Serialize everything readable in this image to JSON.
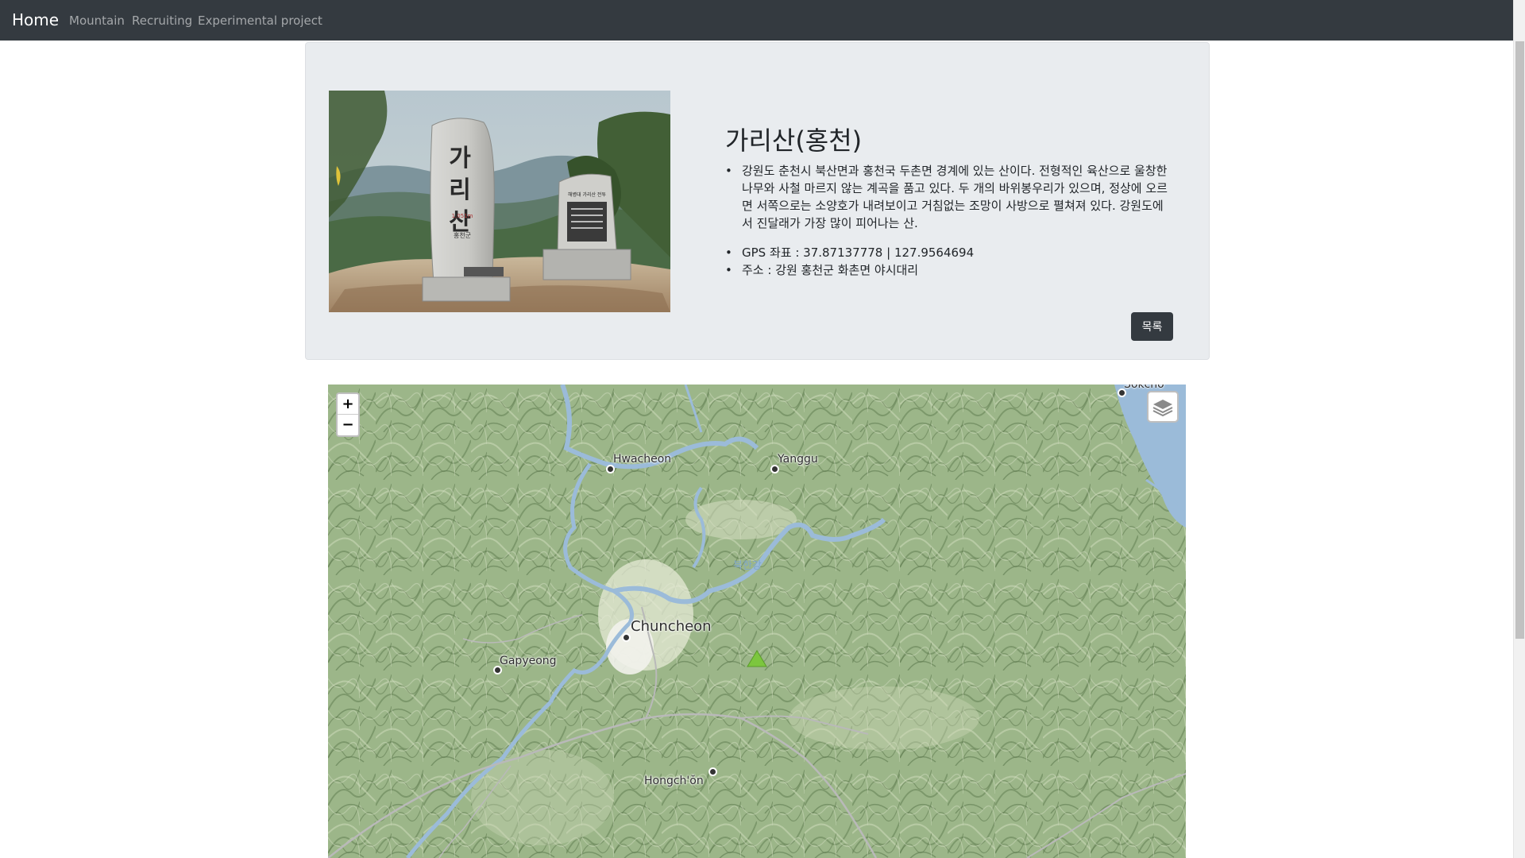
{
  "navbar": {
    "brand": "Home",
    "links": [
      "Mountain",
      "Recruiting",
      "Experimental project"
    ]
  },
  "mountain": {
    "name": "가리산(홍천)",
    "description": "강원도 춘천시 북산면과 홍천국 두촌면 경계에 있는 산이다. 전형적인 육산으로 울창한 나무와 사철 마르지 않는 계곡을 품고 있다. 두 개의 바위봉우리가 있으며, 정상에 오르면 서쪽으로는 소양호가 내려보이고 거침없는 조망이 사방으로 펼쳐져 있다. 강원도에서 진달래가 가장 많이 피어나는 산.",
    "gps": "GPS 좌표 : 37.87137778 | 127.9564694",
    "address": "주소 : 강원 홍천군 화촌면 야시대리",
    "list_button": "목록",
    "photo_text": {
      "stone_text": "가리산",
      "stone_height": "1,051m",
      "stone_county": "홍천군",
      "plaque_title": "해병대 가리산 전투"
    }
  },
  "map": {
    "zoom_in": "+",
    "zoom_out": "−",
    "cities": {
      "hwacheon": "Hwacheon",
      "yanggu": "Yanggu",
      "chuncheon": "Chuncheon",
      "gapyeong": "Gapyeong",
      "hongcheon": "Hongch'ŏn",
      "sokcho": "Sokcho"
    },
    "river": "북한강",
    "colors": {
      "terrain": "#9db58b",
      "water": "#9bbbd9",
      "marker": "#7cc63e"
    }
  }
}
